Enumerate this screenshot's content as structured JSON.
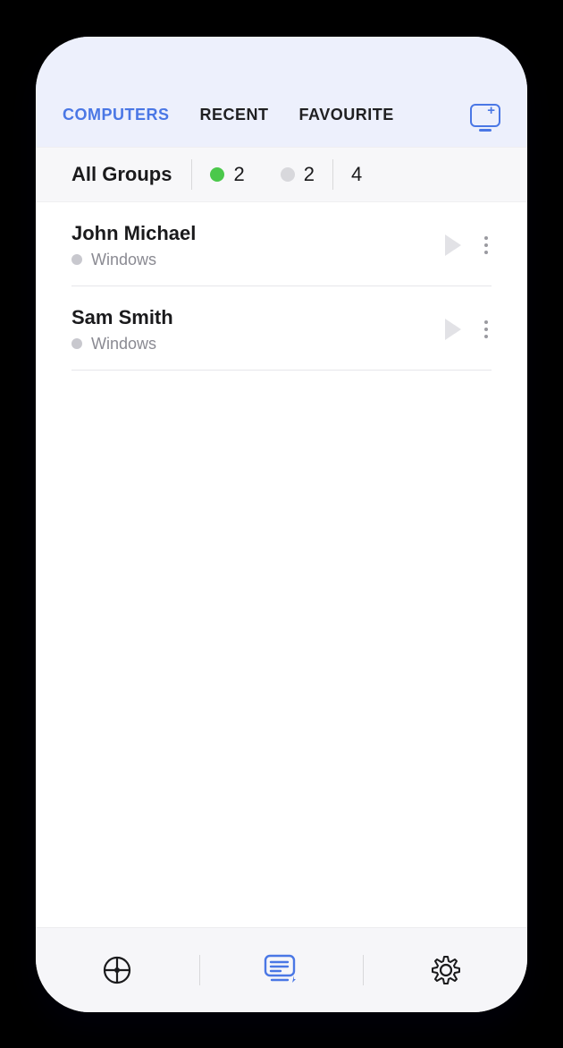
{
  "tabs": {
    "computers": "COMPUTERS",
    "recent": "RECENT",
    "favourite": "FAVOURITE",
    "active": "computers"
  },
  "filter": {
    "label": "All Groups",
    "online_count": "2",
    "offline_count": "2",
    "total_count": "4"
  },
  "devices": [
    {
      "name": "John Michael",
      "os": "Windows"
    },
    {
      "name": "Sam Smith",
      "os": "Windows"
    }
  ],
  "colors": {
    "accent": "#4a77e5",
    "online": "#4bc84b",
    "offline": "#d8d8dc"
  },
  "icons": {
    "add_monitor": "add-monitor-icon",
    "play": "play-icon",
    "more": "more-vertical-icon",
    "nav_target": "target-icon",
    "nav_computers": "computers-list-icon",
    "nav_settings": "gear-icon"
  }
}
